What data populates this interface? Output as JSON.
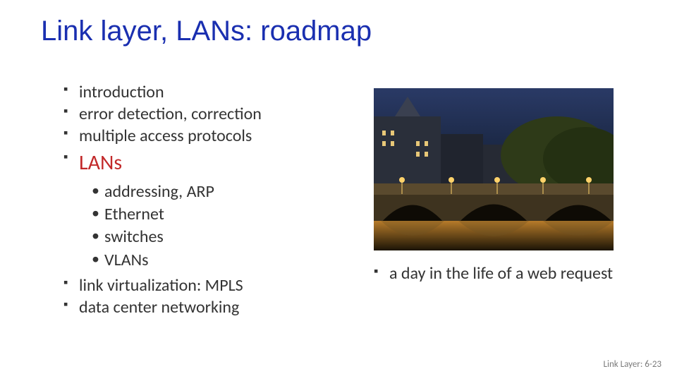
{
  "title": "Link layer, LANs: roadmap",
  "left_items": [
    {
      "label": "introduction",
      "highlight": false
    },
    {
      "label": "error detection, correction",
      "highlight": false
    },
    {
      "label": "multiple access protocols",
      "highlight": false
    },
    {
      "label": "LANs",
      "highlight": true
    }
  ],
  "sub_items": [
    {
      "label": "addressing, ARP"
    },
    {
      "label": "Ethernet"
    },
    {
      "label": "switches"
    },
    {
      "label": "VLANs"
    }
  ],
  "left_tail_items": [
    {
      "label": "link virtualization: MPLS"
    },
    {
      "label": "data center networking"
    }
  ],
  "right_items": [
    {
      "label": "a day in the life of a web request"
    }
  ],
  "footer": "Link Layer: 6-23",
  "image_alt": "paris-bridge-night"
}
